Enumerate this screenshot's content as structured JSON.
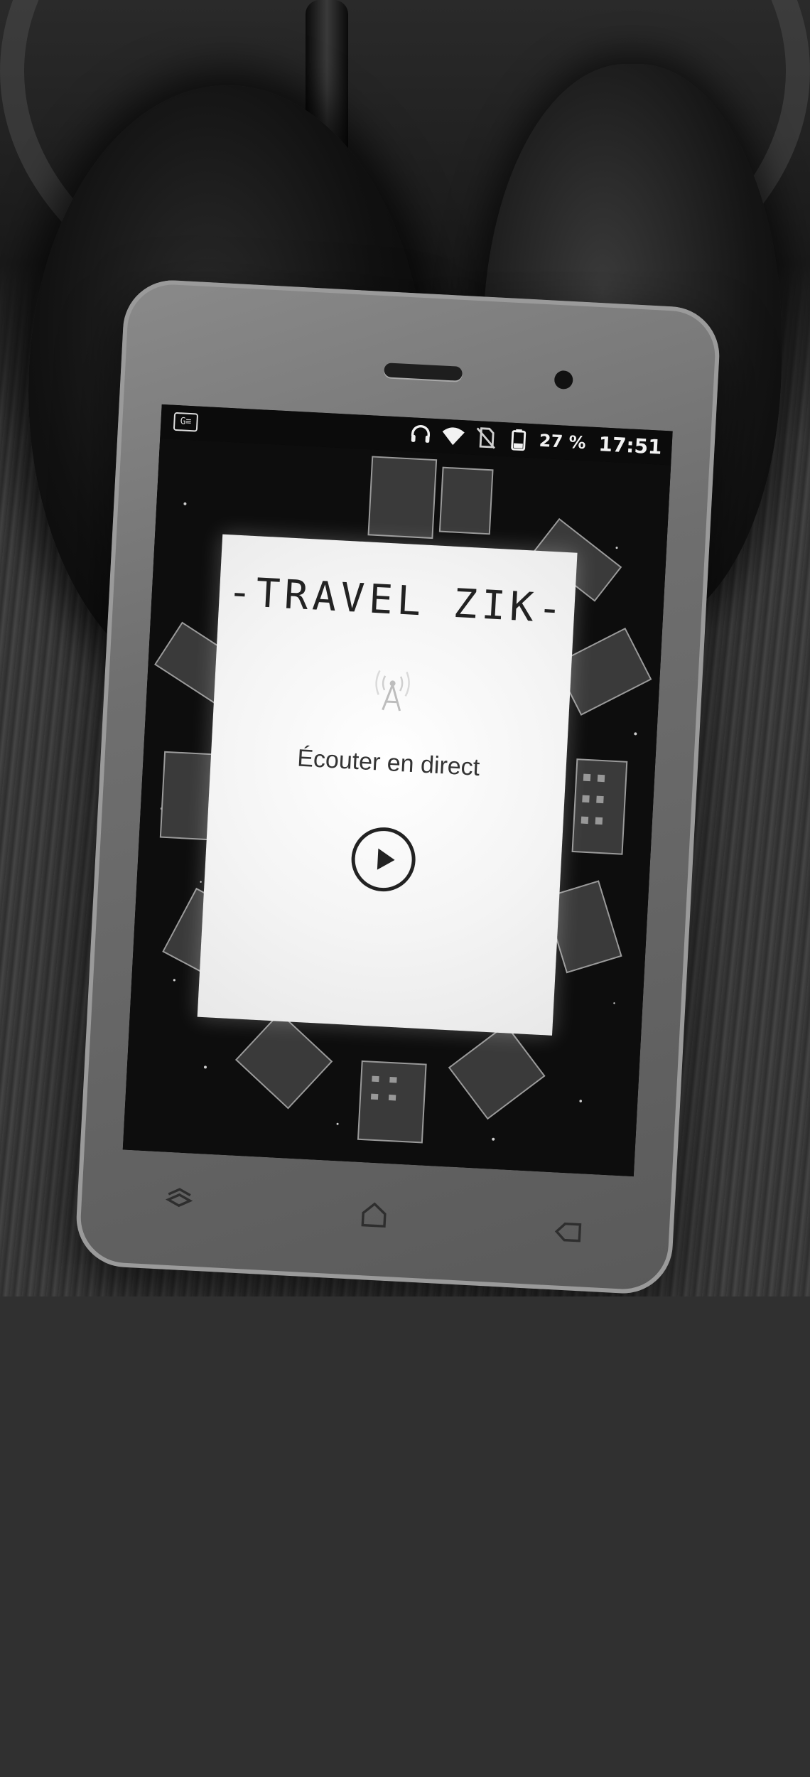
{
  "status_bar": {
    "sim_label": "G≡",
    "battery_percent": "27 %",
    "time": "17:51"
  },
  "app": {
    "brand": "-TRAVEL ZIK-",
    "listen_label": "Écouter en direct"
  },
  "icons": {
    "headphones": "headphones-icon",
    "wifi": "wifi-icon",
    "no_sim": "no-sim-icon",
    "battery": "battery-icon",
    "antenna": "radio-antenna-icon",
    "play": "play-icon",
    "recent_apps": "recent-apps-icon",
    "home": "home-icon",
    "back": "back-icon"
  },
  "colors": {
    "card": "#f4f4f4",
    "wallpaper": "#0b0b0b",
    "page_bottom": "#303030"
  }
}
